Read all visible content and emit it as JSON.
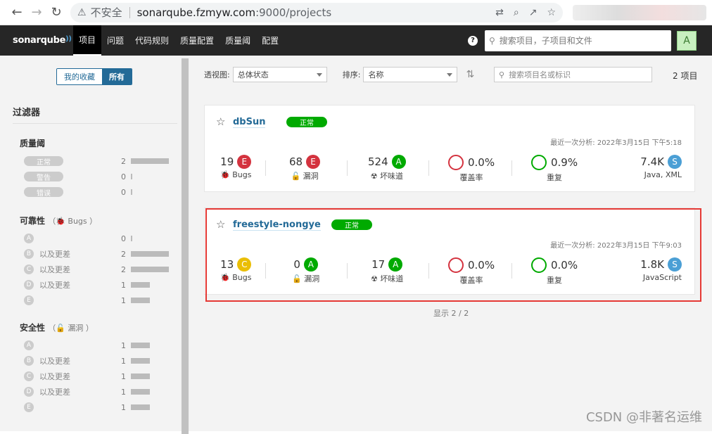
{
  "browser": {
    "insecure_label": "不安全",
    "url_host": "sonarqube.fzmyw.com",
    "url_path": ":9000/projects"
  },
  "nav": {
    "logo": "sonarqube",
    "items": [
      "项目",
      "问题",
      "代码规则",
      "质量配置",
      "质量阈",
      "配置"
    ],
    "search_placeholder": "搜索项目，子项目和文件",
    "avatar": "A"
  },
  "sidebar": {
    "favorites": "我的收藏",
    "all": "所有",
    "filters_title": "过滤器",
    "quality_gate": {
      "title": "质量阈",
      "rows": [
        {
          "label": "正常",
          "count": "2"
        },
        {
          "label": "警告",
          "count": "0"
        },
        {
          "label": "错误",
          "count": "0"
        }
      ]
    },
    "reliability": {
      "title": "可靠性",
      "sub": "Bugs",
      "rows": [
        {
          "rating": "A",
          "text": "",
          "count": "0"
        },
        {
          "rating": "B",
          "text": "以及更差",
          "count": "2"
        },
        {
          "rating": "C",
          "text": "以及更差",
          "count": "2"
        },
        {
          "rating": "D",
          "text": "以及更差",
          "count": "1"
        },
        {
          "rating": "E",
          "text": "",
          "count": "1"
        }
      ]
    },
    "security": {
      "title": "安全性",
      "sub": "漏洞",
      "rows": [
        {
          "rating": "A",
          "text": "",
          "count": "1"
        },
        {
          "rating": "B",
          "text": "以及更差",
          "count": "1"
        },
        {
          "rating": "C",
          "text": "以及更差",
          "count": "1"
        },
        {
          "rating": "D",
          "text": "以及更差",
          "count": "1"
        },
        {
          "rating": "E",
          "text": "",
          "count": "1"
        }
      ]
    }
  },
  "toolbar": {
    "perspective_label": "透视图:",
    "perspective_value": "总体状态",
    "sort_label": "排序:",
    "sort_value": "名称",
    "search_placeholder": "搜索项目名或标识",
    "count": "2 项目"
  },
  "projects": [
    {
      "name": "dbSun",
      "status": "正常",
      "last_analysis": "最近一次分析: 2022年3月15日 下午5:18",
      "bugs": {
        "value": "19",
        "rating": "E",
        "label": "Bugs"
      },
      "vulns": {
        "value": "68",
        "rating": "E",
        "label": "漏洞"
      },
      "smells": {
        "value": "524",
        "rating": "A",
        "label": "坏味道"
      },
      "coverage": {
        "value": "0.0%",
        "label": "覆盖率"
      },
      "dup": {
        "value": "0.9%",
        "label": "重复"
      },
      "size": {
        "value": "7.4K",
        "rating": "S",
        "lang": "Java, XML"
      }
    },
    {
      "name": "freestyle-nongye",
      "status": "正常",
      "last_analysis": "最近一次分析: 2022年3月15日 下午9:03",
      "bugs": {
        "value": "13",
        "rating": "C",
        "label": "Bugs"
      },
      "vulns": {
        "value": "0",
        "rating": "A",
        "label": "漏洞"
      },
      "smells": {
        "value": "17",
        "rating": "A",
        "label": "坏味道"
      },
      "coverage": {
        "value": "0.0%",
        "label": "覆盖率"
      },
      "dup": {
        "value": "0.0%",
        "label": "重复"
      },
      "size": {
        "value": "1.8K",
        "rating": "S",
        "lang": "JavaScript"
      }
    }
  ],
  "footer": "显示 2 / 2",
  "watermark": "CSDN @非著名运维"
}
